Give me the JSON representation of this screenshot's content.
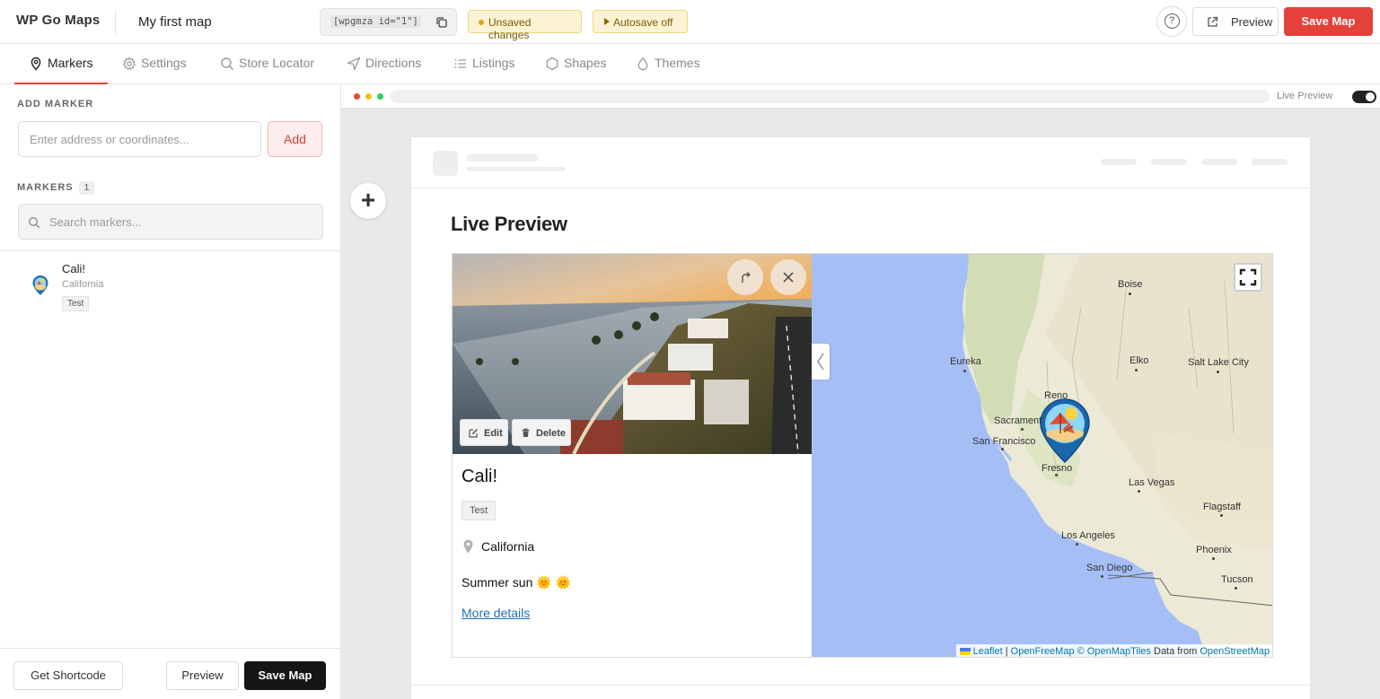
{
  "app": {
    "logo": "WP Go Maps",
    "map_title": "My first map",
    "shortcode": "[wpgmza id=\"1\"]",
    "status_unsaved": "Unsaved changes",
    "status_autosave": "Autosave off",
    "help_symbol": "?",
    "preview_label": "Preview",
    "save_label": "Save Map",
    "accent_color": "#e5413b"
  },
  "tabs": [
    {
      "label": "Markers",
      "icon": "pin-icon",
      "active": true
    },
    {
      "label": "Settings",
      "icon": "gear-icon"
    },
    {
      "label": "Store Locator",
      "icon": "search-icon"
    },
    {
      "label": "Directions",
      "icon": "navigation-icon"
    },
    {
      "label": "Listings",
      "icon": "list-icon"
    },
    {
      "label": "Shapes",
      "icon": "hexagon-icon"
    },
    {
      "label": "Themes",
      "icon": "droplet-icon"
    }
  ],
  "sidebar": {
    "add_marker_label": "ADD MARKER",
    "address_placeholder": "Enter address or coordinates...",
    "add_button": "Add",
    "markers_label": "MARKERS",
    "markers_count": "1",
    "search_placeholder": "Search markers...",
    "markers": [
      {
        "name": "Cali!",
        "address": "California",
        "tag": "Test"
      }
    ],
    "footer": {
      "get_shortcode": "Get Shortcode",
      "preview": "Preview",
      "save": "Save Map"
    }
  },
  "preview": {
    "live_preview_toggle_label": "Live Preview",
    "toggle_on": true,
    "add_block_symbol": "+",
    "page_heading": "Live Preview"
  },
  "info_window": {
    "edit": "Edit",
    "delete": "Delete",
    "title": "Cali!",
    "tag": "Test",
    "address": "California",
    "description": "Summer sun 🌞 🌞",
    "link": "More details"
  },
  "map": {
    "cities": [
      "Boise",
      "Eureka",
      "Elko",
      "Salt Lake City",
      "Reno",
      "Sacramento",
      "San Francisco",
      "Fresno",
      "Las Vegas",
      "Flagstaff",
      "Los Angeles",
      "Phoenix",
      "San Diego",
      "Tucson"
    ],
    "attribution": {
      "leaflet": "Leaflet",
      "sep": " | ",
      "ofm": "OpenFreeMap",
      "omt": "© OpenMapTiles",
      "data_from": " Data from ",
      "osm": "OpenStreetMap"
    }
  }
}
